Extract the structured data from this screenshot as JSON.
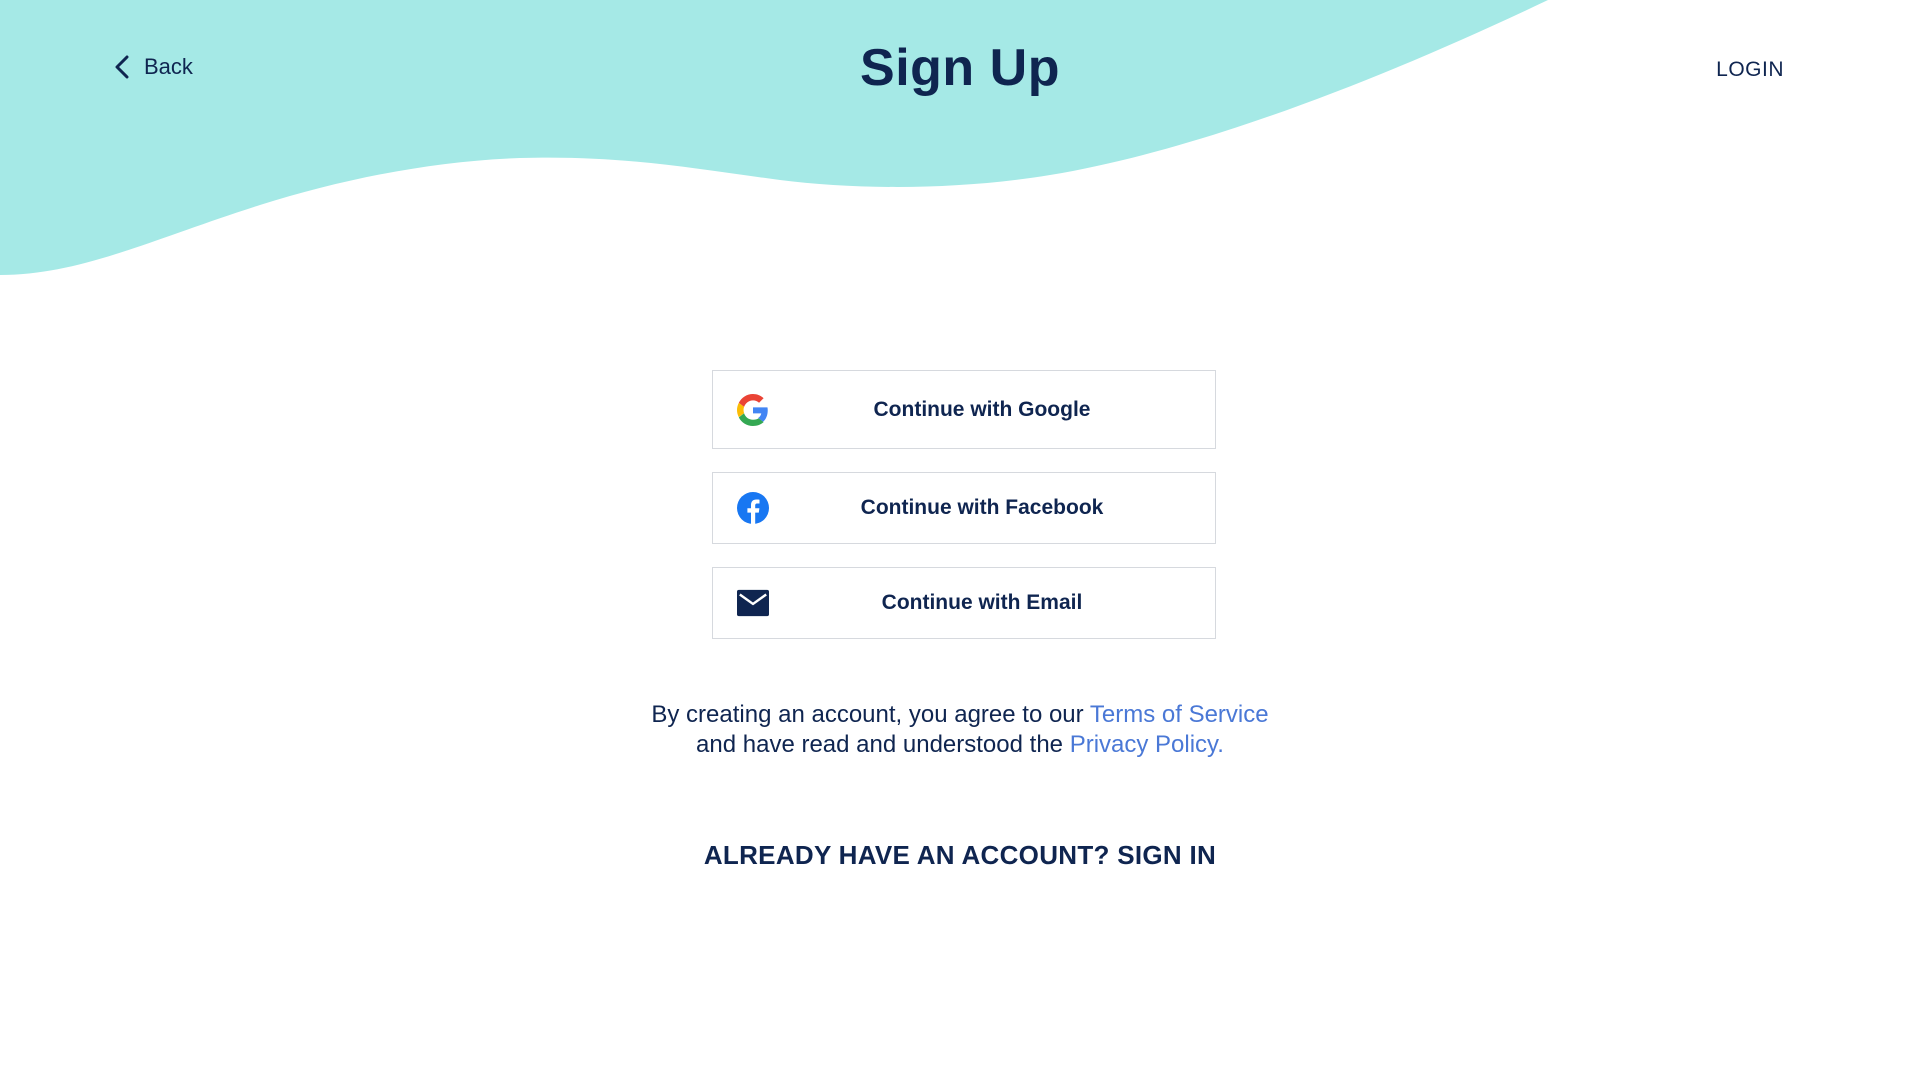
{
  "header": {
    "back_label": "Back",
    "title": "Sign Up",
    "login_label": "LOGIN"
  },
  "auth": {
    "google_label": "Continue with Google",
    "facebook_label": "Continue with Facebook",
    "email_label": "Continue with Email"
  },
  "terms": {
    "line1_prefix": "By creating an account, you agree to our ",
    "terms_link": "Terms of Service",
    "line2_prefix": "and have read and understood the ",
    "privacy_link": "Privacy Policy."
  },
  "signin": {
    "label": "ALREADY HAVE AN ACCOUNT? SIGN IN"
  },
  "colors": {
    "wave": "#a5e9e6",
    "text_primary": "#0f2550",
    "link": "#4a78d6",
    "button_border": "#d6d9de",
    "facebook_blue": "#1877f2"
  },
  "icons": {
    "back": "chevron-left-icon",
    "google": "google-icon",
    "facebook": "facebook-icon",
    "email": "mail-icon"
  }
}
